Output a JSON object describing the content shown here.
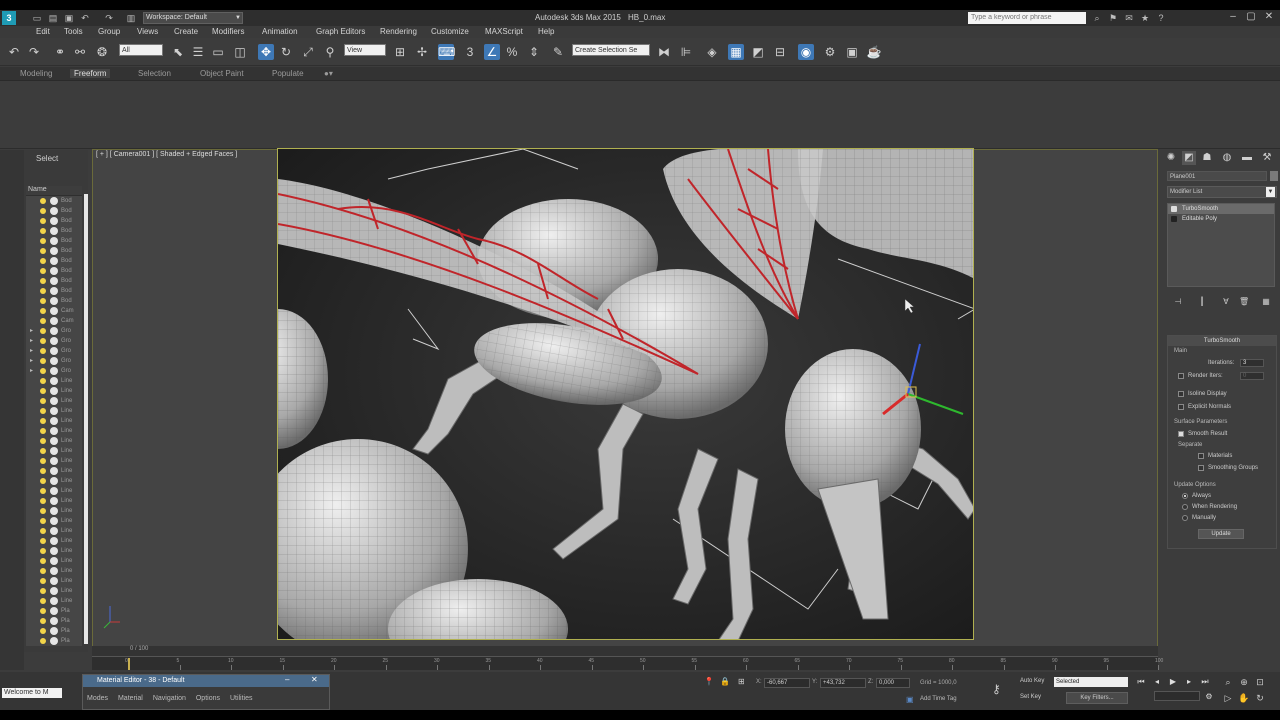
{
  "titlebar": {
    "workspace": "Workspace: Default",
    "title": "Autodesk 3ds Max 2015",
    "file": "HB_0.max",
    "search_placeholder": "Type a keyword or phrase"
  },
  "menu": [
    "Edit",
    "Tools",
    "Group",
    "Views",
    "Create",
    "Modifiers",
    "Animation",
    "Graph Editors",
    "Rendering",
    "Customize",
    "MAXScript",
    "Help"
  ],
  "toolbar": {
    "selection_filter": "All",
    "ref_coord": "View",
    "named_selection": "Create Selection Se"
  },
  "ribbon": {
    "tabs": [
      "Modeling",
      "Freeform",
      "Selection",
      "Object Paint",
      "Populate"
    ],
    "active_tab": "Freeform"
  },
  "explorer": {
    "title": "Select",
    "column_header": "Name",
    "rows": [
      {
        "exp": "",
        "name": "Bod"
      },
      {
        "exp": "",
        "name": "Bod"
      },
      {
        "exp": "",
        "name": "Bod"
      },
      {
        "exp": "",
        "name": "Bod"
      },
      {
        "exp": "",
        "name": "Bod"
      },
      {
        "exp": "",
        "name": "Bod"
      },
      {
        "exp": "",
        "name": "Bod"
      },
      {
        "exp": "",
        "name": "Bod"
      },
      {
        "exp": "",
        "name": "Bod"
      },
      {
        "exp": "",
        "name": "Bod"
      },
      {
        "exp": "",
        "name": "Bod"
      },
      {
        "exp": "",
        "name": "Cam"
      },
      {
        "exp": "",
        "name": "Cam"
      },
      {
        "exp": "▸",
        "name": "Gro"
      },
      {
        "exp": "▸",
        "name": "Gro"
      },
      {
        "exp": "▸",
        "name": "Gro"
      },
      {
        "exp": "▸",
        "name": "Gro"
      },
      {
        "exp": "▸",
        "name": "Gro"
      },
      {
        "exp": "",
        "name": "Line"
      },
      {
        "exp": "",
        "name": "Line"
      },
      {
        "exp": "",
        "name": "Line"
      },
      {
        "exp": "",
        "name": "Line"
      },
      {
        "exp": "",
        "name": "Line"
      },
      {
        "exp": "",
        "name": "Line"
      },
      {
        "exp": "",
        "name": "Line"
      },
      {
        "exp": "",
        "name": "Line"
      },
      {
        "exp": "",
        "name": "Line"
      },
      {
        "exp": "",
        "name": "Line"
      },
      {
        "exp": "",
        "name": "Line"
      },
      {
        "exp": "",
        "name": "Line"
      },
      {
        "exp": "",
        "name": "Line"
      },
      {
        "exp": "",
        "name": "Line"
      },
      {
        "exp": "",
        "name": "Line"
      },
      {
        "exp": "",
        "name": "Line"
      },
      {
        "exp": "",
        "name": "Line"
      },
      {
        "exp": "",
        "name": "Line"
      },
      {
        "exp": "",
        "name": "Line"
      },
      {
        "exp": "",
        "name": "Line"
      },
      {
        "exp": "",
        "name": "Line"
      },
      {
        "exp": "",
        "name": "Line"
      },
      {
        "exp": "",
        "name": "Line"
      },
      {
        "exp": "",
        "name": "Pla"
      },
      {
        "exp": "",
        "name": "Pla"
      },
      {
        "exp": "",
        "name": "Pla"
      },
      {
        "exp": "",
        "name": "Pla"
      }
    ]
  },
  "viewport": {
    "label": "[ + ] [ Camera001 ] [ Shaded + Edged Faces ]"
  },
  "command_panel": {
    "object_name": "Plane001",
    "modifier_list": "Modifier List",
    "stack": [
      "TurboSmooth",
      "Editable Poly"
    ],
    "rollout_title": "TurboSmooth",
    "main_group": "Main",
    "iterations_label": "Iterations:",
    "iterations_value": "3",
    "render_iters_label": "Render Iters:",
    "render_iters_value": "0",
    "isoline_display": "Isoline Display",
    "explicit_normals": "Explicit Normals",
    "surface_params": "Surface Parameters",
    "smooth_result": "Smooth Result",
    "separate": "Separate",
    "materials": "Materials",
    "smoothing_groups": "Smoothing Groups",
    "update_options": "Update Options",
    "always": "Always",
    "when_rendering": "When Rendering",
    "manually": "Manually",
    "update_btn": "Update"
  },
  "timeline": {
    "slider_label": "0 / 100",
    "ticks": [
      "0",
      "5",
      "10",
      "15",
      "20",
      "25",
      "30",
      "35",
      "40",
      "45",
      "50",
      "55",
      "60",
      "65",
      "70",
      "75",
      "80",
      "85",
      "90",
      "95",
      "100"
    ]
  },
  "statusbar": {
    "listener": "Welcome to M",
    "material_editor_title": "Material Editor - 38 - Default",
    "material_editor_menu": [
      "Modes",
      "Material",
      "Navigation",
      "Options",
      "Utilities"
    ],
    "x_label": "X:",
    "x_value": "-60,667",
    "y_label": "Y:",
    "y_value": "+43,732",
    "z_label": "Z:",
    "z_value": "0,000",
    "grid": "Grid = 1000,0",
    "add_time_tag": "Add Time Tag",
    "auto_key": "Auto Key",
    "set_key": "Set Key",
    "selected": "Selected",
    "key_filters": "Key Filters..."
  }
}
